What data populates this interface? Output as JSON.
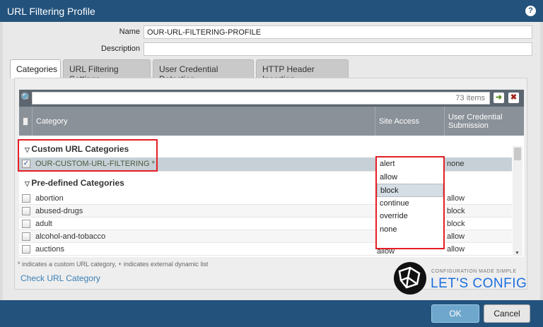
{
  "title": "URL Filtering Profile",
  "form": {
    "name_label": "Name",
    "name_value": "OUR-URL-FILTERING-PROFILE",
    "description_label": "Description",
    "description_value": ""
  },
  "tabs": [
    {
      "label": "Categories"
    },
    {
      "label": "URL Filtering Settings"
    },
    {
      "label": "User Credential Detection"
    },
    {
      "label": "HTTP Header Insertion"
    }
  ],
  "grid": {
    "item_count": "73 items",
    "columns": {
      "category": "Category",
      "site_access": "Site Access",
      "user_credential": "User Credential Submission"
    },
    "custom_group": "Custom URL Categories",
    "custom_row": {
      "category": "OUR-CUSTOM-URL-FILTERING *",
      "site_access": "none",
      "user_credential": "none",
      "checked": true
    },
    "predefined_group": "Pre-defined Categories",
    "rows": [
      {
        "category": "abortion",
        "site_access": "",
        "user_credential": "allow"
      },
      {
        "category": "abused-drugs",
        "site_access": "",
        "user_credential": "block"
      },
      {
        "category": "adult",
        "site_access": "",
        "user_credential": "block"
      },
      {
        "category": "alcohol-and-tobacco",
        "site_access": "",
        "user_credential": "allow"
      },
      {
        "category": "auctions",
        "site_access": "allow",
        "user_credential": "allow"
      }
    ],
    "dropdown_options": [
      "alert",
      "allow",
      "block",
      "continue",
      "override",
      "none"
    ],
    "dropdown_highlighted": "block"
  },
  "footnote": "* indicates a custom URL category, + indicates external dynamic list",
  "check_link": "Check URL Category",
  "logo": {
    "tagline": "CONFIGURATION MADE SIMPLE",
    "name": "LET'S CONFIG"
  },
  "buttons": {
    "ok": "OK",
    "cancel": "Cancel"
  },
  "colors": {
    "titlebar": "#23527c",
    "highlight": "#e31e24",
    "link": "#3a7fb5"
  }
}
